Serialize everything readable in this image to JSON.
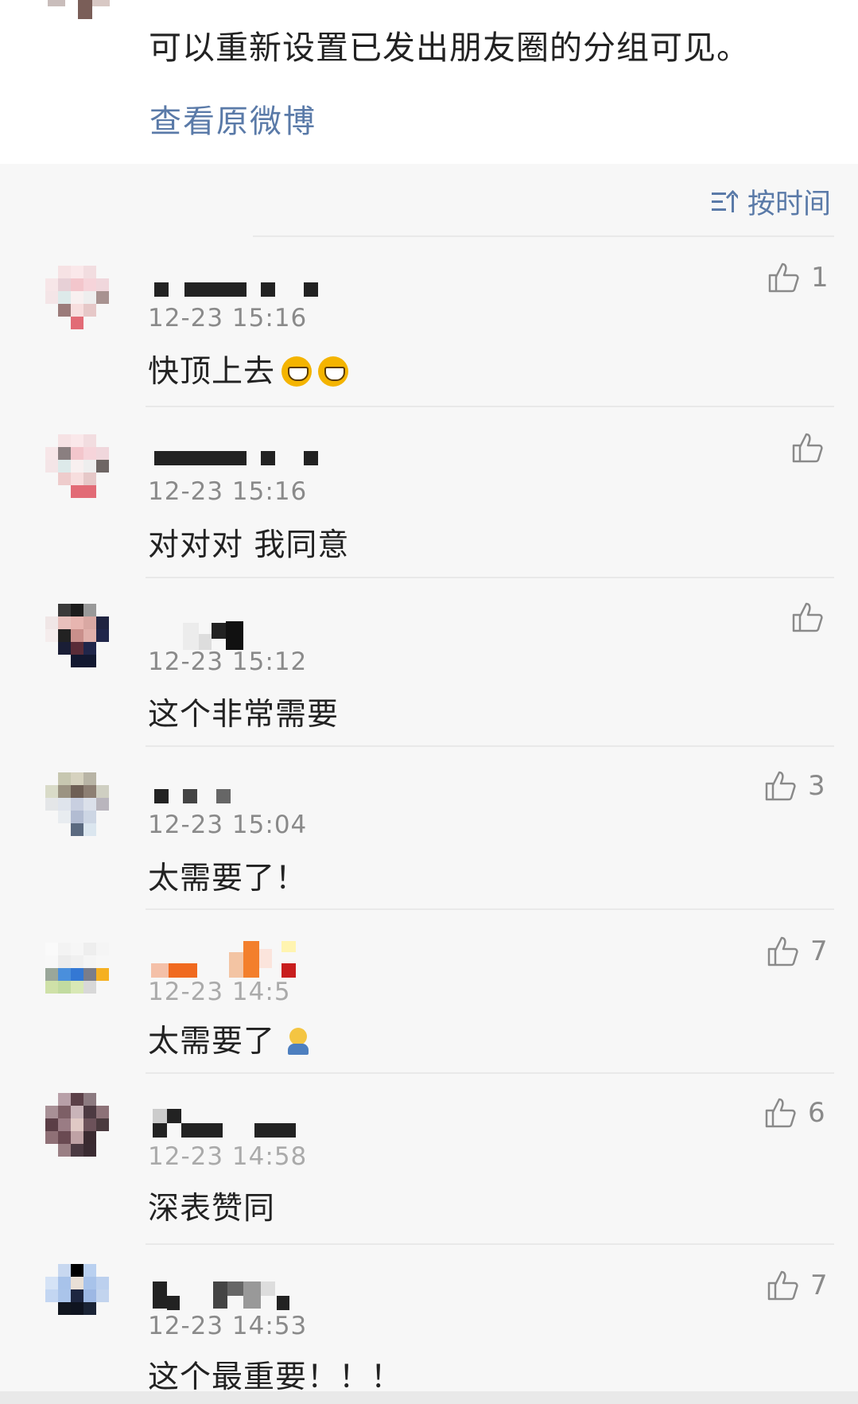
{
  "post": {
    "text": "可以重新设置已发出朋友圈的分组可见。",
    "view_original": "查看原微博"
  },
  "sort": {
    "label": "按时间",
    "icon": "sort-icon"
  },
  "comments": [
    {
      "time": "12-23 15:16",
      "text": "快顶上去",
      "likes": "1",
      "emoji": "laughing-emoji"
    },
    {
      "time": "12-23 15:16",
      "text": "对对对 我同意",
      "likes": ""
    },
    {
      "time": "12-23 15:12",
      "text": "这个非常需要",
      "likes": ""
    },
    {
      "time": "12-23 15:04",
      "text": "太需要了！",
      "likes": "3"
    },
    {
      "time": "12-23 14:5",
      "text": "太需要了",
      "likes": "7",
      "emoji": "praying-emoji"
    },
    {
      "time": "12-23 14:58",
      "text": "深表赞同",
      "likes": "6"
    },
    {
      "time": "12-23 14:53",
      "text": "这个最重要！！！",
      "likes": "7"
    }
  ],
  "colors": {
    "link": "#5a7aa8",
    "text": "#222222",
    "meta": "#8a8a8a",
    "background": "#f7f7f7"
  }
}
